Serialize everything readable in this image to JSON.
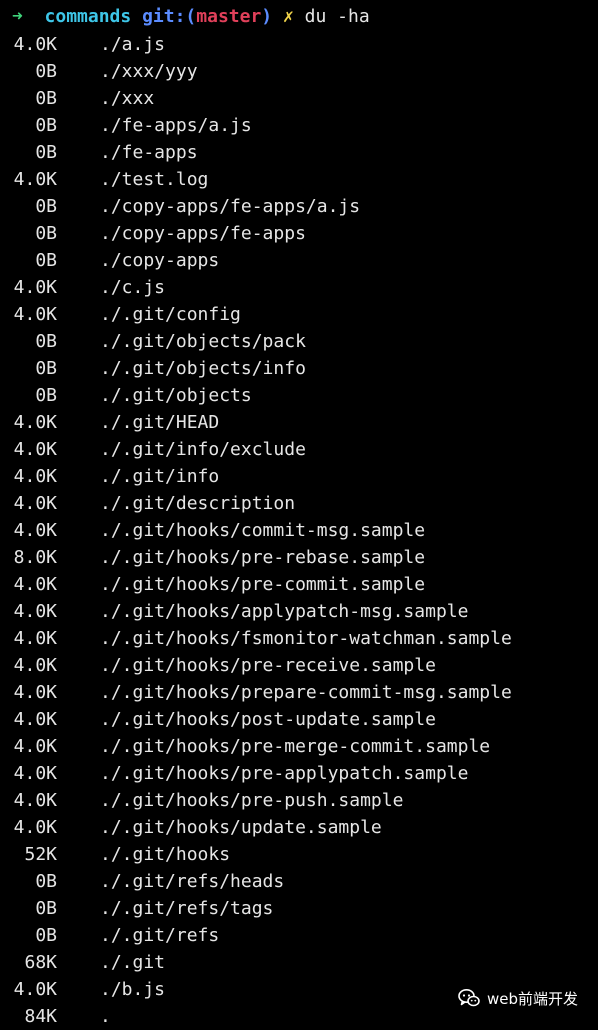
{
  "prompt": {
    "arrow": "➜",
    "directory": "commands",
    "git_label": "git:(",
    "branch": "master",
    "git_close": ")",
    "dirty_marker": "✗",
    "command": "du -ha"
  },
  "output": [
    {
      "size": "4.0K",
      "path": "./a.js"
    },
    {
      "size": "0B",
      "path": "./xxx/yyy"
    },
    {
      "size": "0B",
      "path": "./xxx"
    },
    {
      "size": "0B",
      "path": "./fe-apps/a.js"
    },
    {
      "size": "0B",
      "path": "./fe-apps"
    },
    {
      "size": "4.0K",
      "path": "./test.log"
    },
    {
      "size": "0B",
      "path": "./copy-apps/fe-apps/a.js"
    },
    {
      "size": "0B",
      "path": "./copy-apps/fe-apps"
    },
    {
      "size": "0B",
      "path": "./copy-apps"
    },
    {
      "size": "4.0K",
      "path": "./c.js"
    },
    {
      "size": "4.0K",
      "path": "./.git/config"
    },
    {
      "size": "0B",
      "path": "./.git/objects/pack"
    },
    {
      "size": "0B",
      "path": "./.git/objects/info"
    },
    {
      "size": "0B",
      "path": "./.git/objects"
    },
    {
      "size": "4.0K",
      "path": "./.git/HEAD"
    },
    {
      "size": "4.0K",
      "path": "./.git/info/exclude"
    },
    {
      "size": "4.0K",
      "path": "./.git/info"
    },
    {
      "size": "4.0K",
      "path": "./.git/description"
    },
    {
      "size": "4.0K",
      "path": "./.git/hooks/commit-msg.sample"
    },
    {
      "size": "8.0K",
      "path": "./.git/hooks/pre-rebase.sample"
    },
    {
      "size": "4.0K",
      "path": "./.git/hooks/pre-commit.sample"
    },
    {
      "size": "4.0K",
      "path": "./.git/hooks/applypatch-msg.sample"
    },
    {
      "size": "4.0K",
      "path": "./.git/hooks/fsmonitor-watchman.sample"
    },
    {
      "size": "4.0K",
      "path": "./.git/hooks/pre-receive.sample"
    },
    {
      "size": "4.0K",
      "path": "./.git/hooks/prepare-commit-msg.sample"
    },
    {
      "size": "4.0K",
      "path": "./.git/hooks/post-update.sample"
    },
    {
      "size": "4.0K",
      "path": "./.git/hooks/pre-merge-commit.sample"
    },
    {
      "size": "4.0K",
      "path": "./.git/hooks/pre-applypatch.sample"
    },
    {
      "size": "4.0K",
      "path": "./.git/hooks/pre-push.sample"
    },
    {
      "size": "4.0K",
      "path": "./.git/hooks/update.sample"
    },
    {
      "size": "52K",
      "path": "./.git/hooks"
    },
    {
      "size": "0B",
      "path": "./.git/refs/heads"
    },
    {
      "size": "0B",
      "path": "./.git/refs/tags"
    },
    {
      "size": "0B",
      "path": "./.git/refs"
    },
    {
      "size": "68K",
      "path": "./.git"
    },
    {
      "size": "4.0K",
      "path": "./b.js"
    },
    {
      "size": "84K",
      "path": "."
    }
  ],
  "watermark": {
    "icon": "wechat-icon",
    "text": "web前端开发"
  },
  "colors": {
    "background": "#000000",
    "text": "#e6e6e6",
    "arrow": "#3fd27a",
    "directory": "#3ec6e8",
    "git": "#5b8cff",
    "branch": "#e0405a",
    "dirty": "#f2d54a"
  }
}
